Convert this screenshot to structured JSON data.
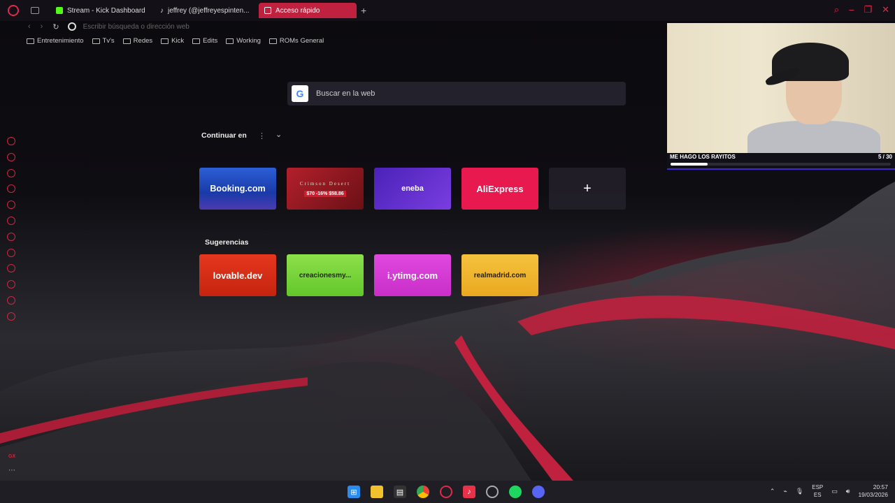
{
  "tabs": [
    {
      "label": "Stream - Kick Dashboard",
      "favicon_color": "#53fc18"
    },
    {
      "label": "jeffrey (@jeffreyespinten...",
      "favicon_color": "#ffffff"
    },
    {
      "label": "Acceso rápido",
      "favicon_color": "#ffffff",
      "active": true
    }
  ],
  "address": {
    "placeholder": "Escribir búsqueda o dirección web",
    "value": ""
  },
  "bookmarks": [
    "Entretenimiento",
    "Tv's",
    "Redes",
    "Kick",
    "Edits",
    "Working",
    "ROMs General"
  ],
  "search": {
    "label": "Buscar en la web"
  },
  "continue": {
    "label": "Continuar en"
  },
  "speed_dial": [
    {
      "label": "Booking.com",
      "bg": "#1a3aa8"
    },
    {
      "label": "Crimson Desert",
      "bg": "#9b1b25",
      "price": "$70 -16% $58.86"
    },
    {
      "label": "eneba",
      "bg": "#5a28c9"
    },
    {
      "label": "AliExpress",
      "bg": "#e8194f"
    },
    {
      "label": "+",
      "bg": "#1c1a22"
    }
  ],
  "suggestions_label": "Sugerencias",
  "suggestions": [
    {
      "label": "lovable.dev",
      "bg": "#e0301e"
    },
    {
      "label": "creacionesmy...",
      "bg": "#7ad63a"
    },
    {
      "label": "i.ytimg.com",
      "bg": "#d93cd8"
    },
    {
      "label": "realmadrid.com",
      "bg": "#f2b631"
    }
  ],
  "webcam": {
    "title": "ME HAGO LOS RAYITOS",
    "count": "5 / 30",
    "progress": 0.167
  },
  "tray": {
    "lang": "ESP",
    "region": "ES",
    "time": "20:57",
    "date": "19/03/2026"
  },
  "accent": "#e0294a"
}
